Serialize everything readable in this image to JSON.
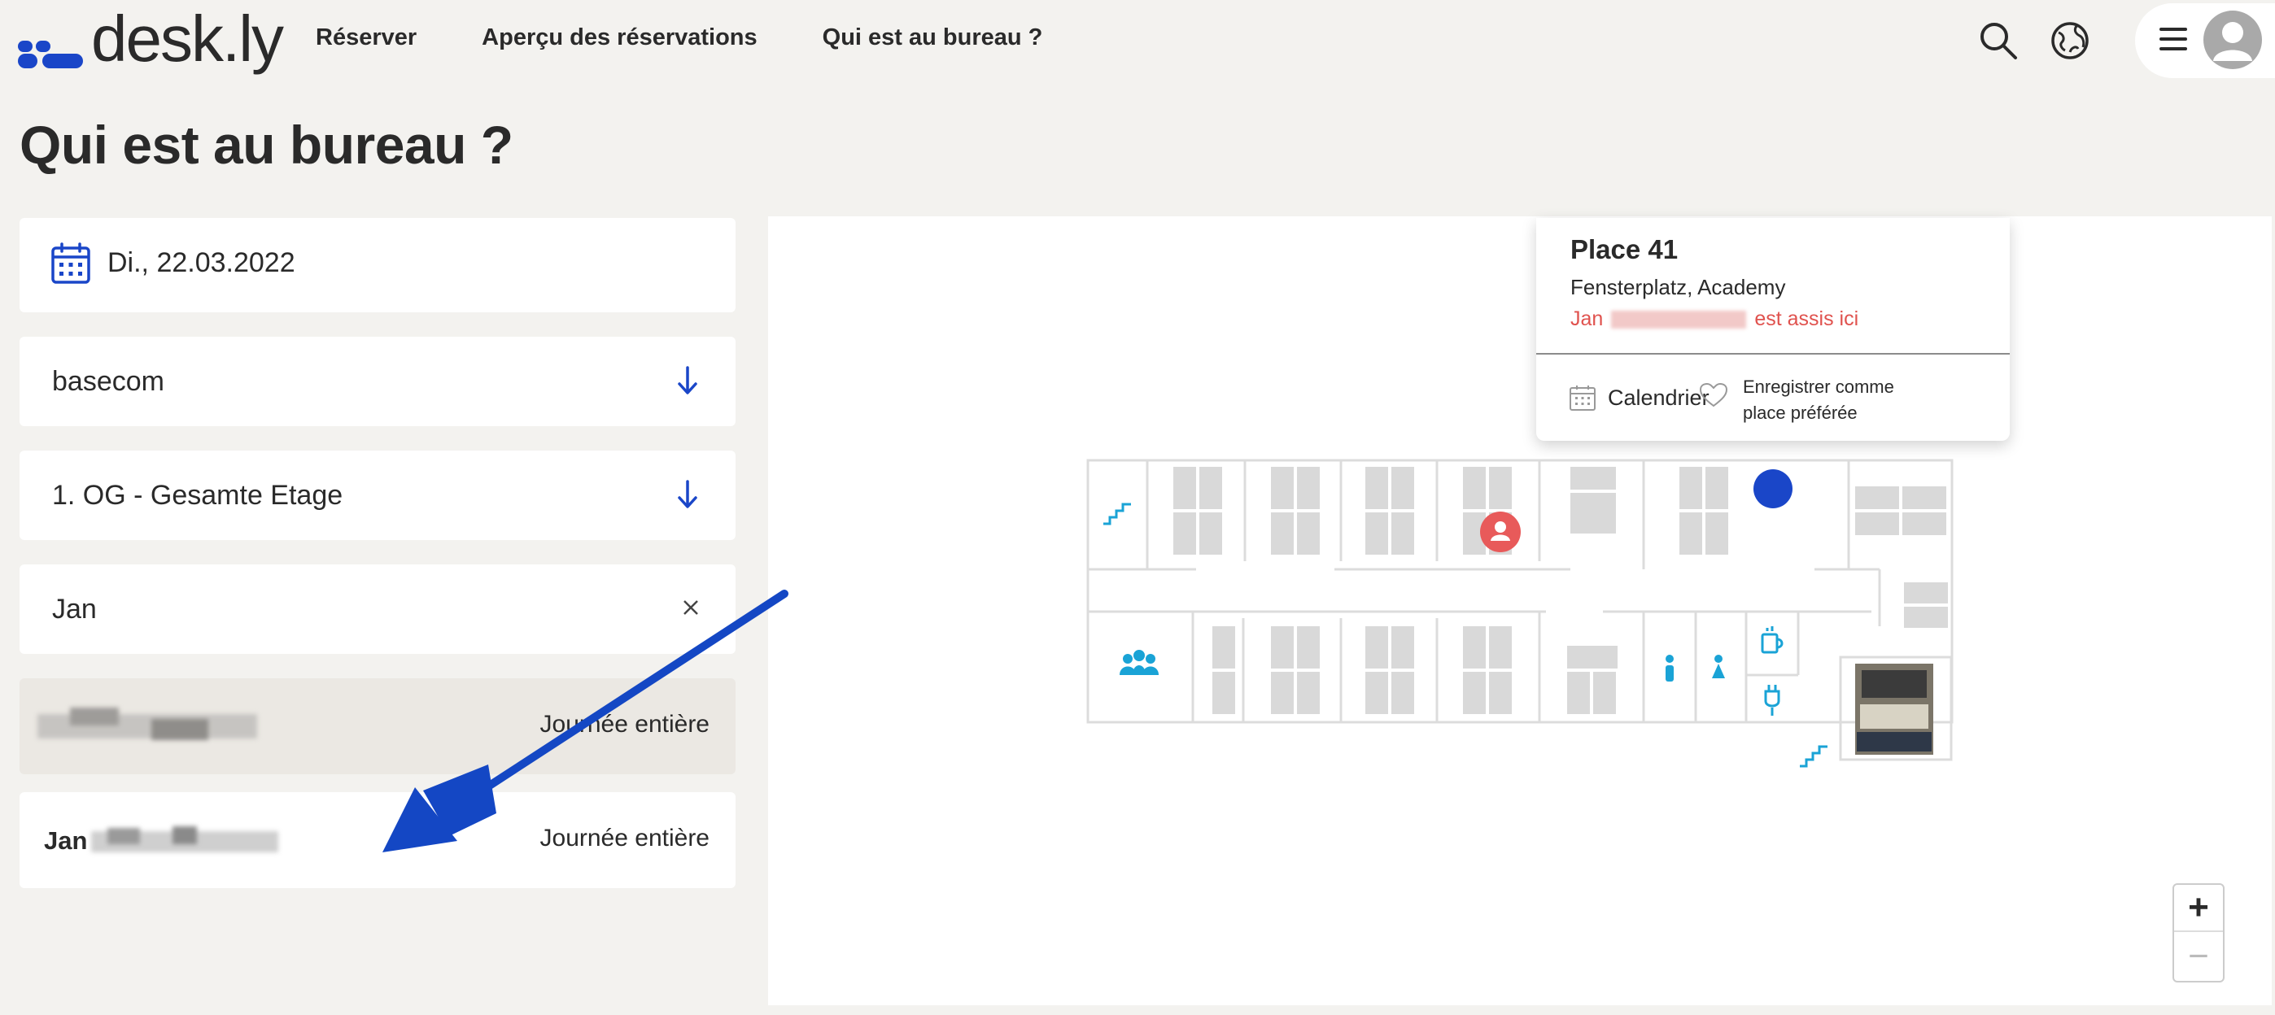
{
  "app": {
    "logo_text": "desk.ly"
  },
  "nav": {
    "items": [
      {
        "label": "Réserver"
      },
      {
        "label": "Aperçu des réservations"
      },
      {
        "label": "Qui est au bureau ?"
      }
    ]
  },
  "page": {
    "title": "Qui est au bureau ?"
  },
  "filters": {
    "date": "Di., 22.03.2022",
    "company": "basecom",
    "floor": "1. OG - Gesamte Etage",
    "search_value": "Jan"
  },
  "results": [
    {
      "first_name": "",
      "time": "Journée entière"
    },
    {
      "first_name": "Jan",
      "time": "Journée entière"
    }
  ],
  "popup": {
    "title": "Place 41",
    "subtitle": "Fensterplatz, Academy",
    "status_first": "Jan",
    "status_suffix": "est assis ici",
    "calendar_label": "Calendrier",
    "favorite_label": "Enregistrer comme place préférée"
  },
  "map": {
    "zoom_in": "+",
    "zoom_out": "−"
  },
  "colors": {
    "accent": "#1a46c8",
    "occupied": "#e85a5a",
    "icons": "#1aa3d6",
    "background": "#f3f2ef"
  }
}
